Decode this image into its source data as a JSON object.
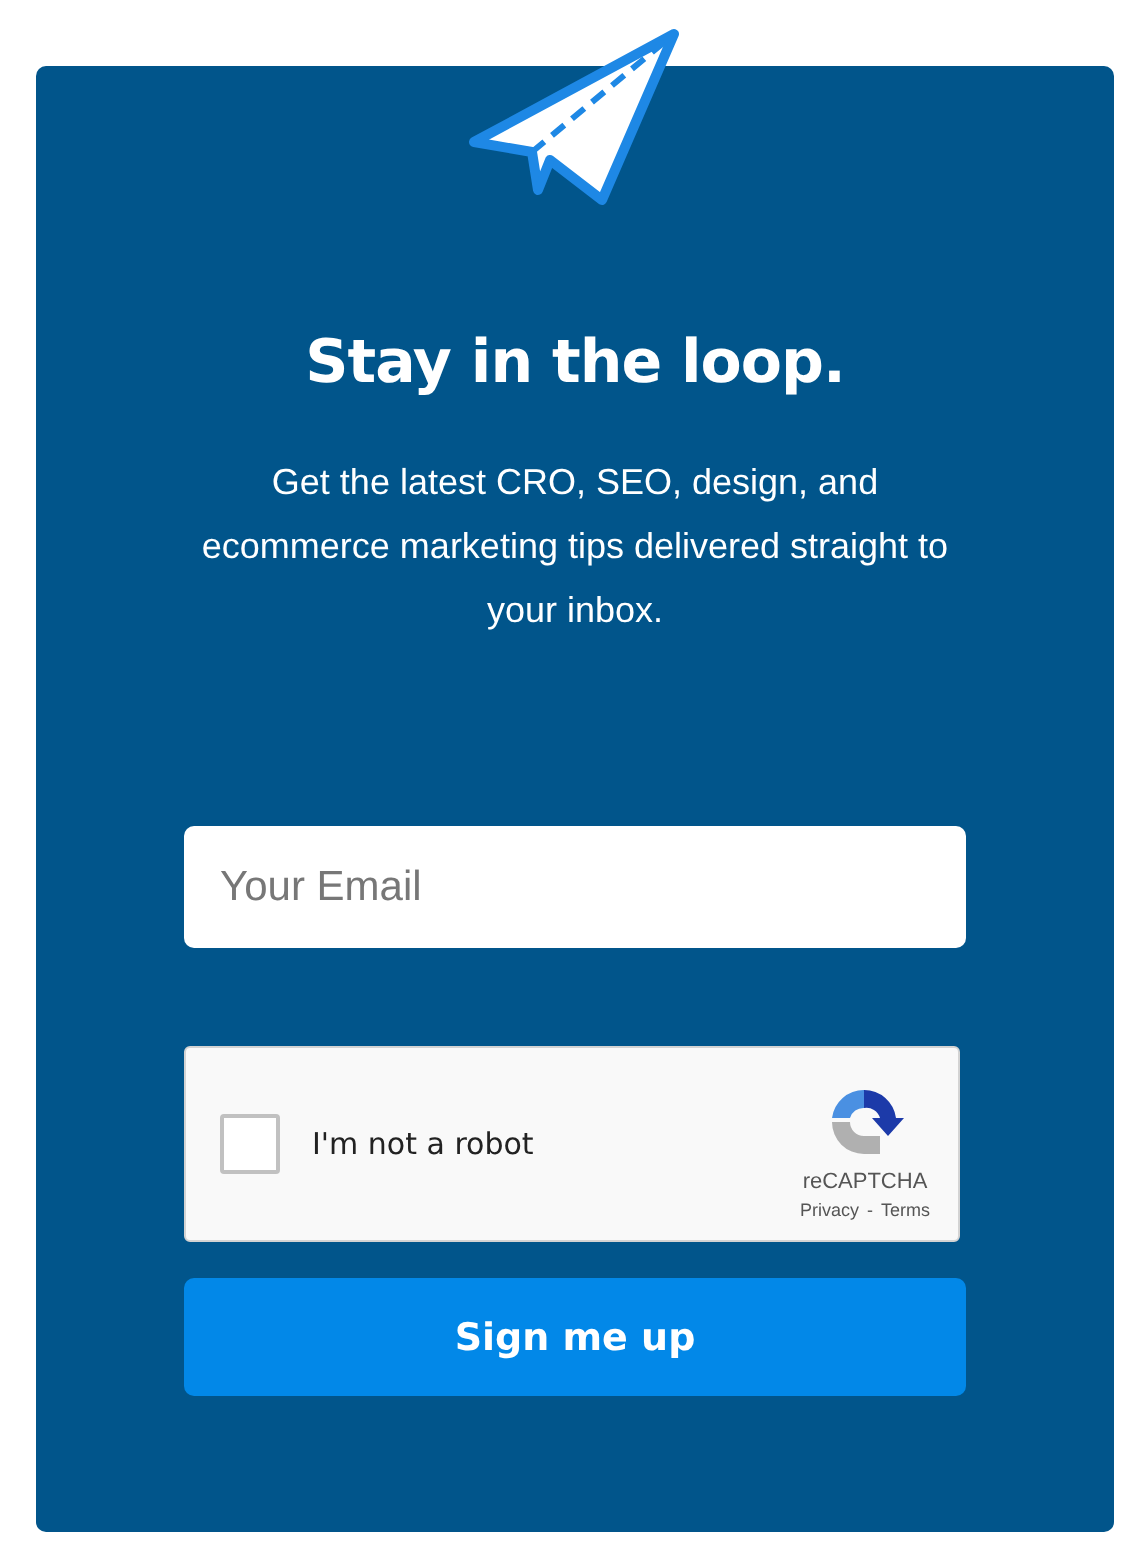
{
  "title": "Stay in the loop.",
  "description": "Get the latest CRO, SEO, design, and ecommerce marketing tips delivered straight to your inbox.",
  "email": {
    "placeholder": "Your Email"
  },
  "captcha": {
    "label": "I'm not a robot",
    "checked": false,
    "brand": "reCAPTCHA",
    "links": [
      "Privacy",
      "Terms"
    ],
    "separator": "-"
  },
  "button": "Sign me up"
}
